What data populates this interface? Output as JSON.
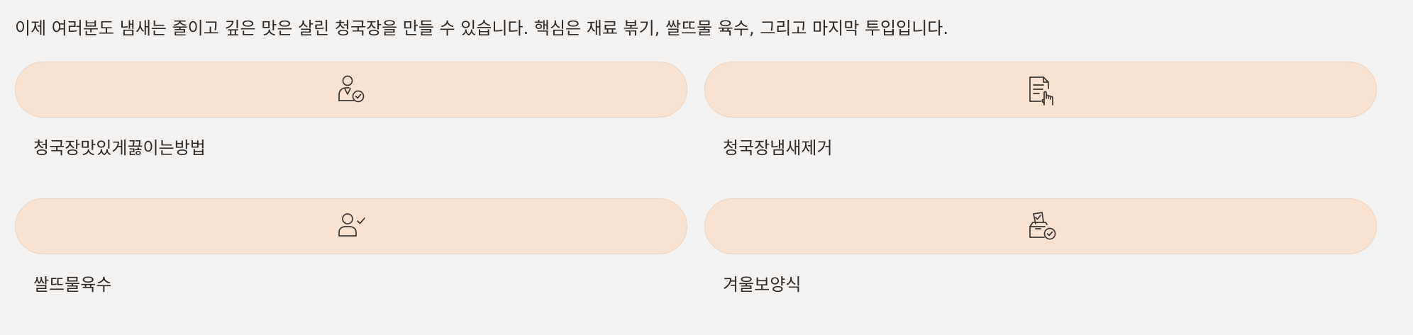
{
  "intro_text": "이제 여러분도 냄새는 줄이고 깊은 맛은 살린 청국장을 만들 수 있습니다. 핵심은 재료 볶기, 쌀뜨물 육수, 그리고 마지막 투입입니다.",
  "cards": [
    {
      "label": "청국장맛있게끓이는방법",
      "icon": "person-check-icon"
    },
    {
      "label": "청국장냄새제거",
      "icon": "document-hand-icon"
    },
    {
      "label": "쌀뜨물육수",
      "icon": "user-check-icon"
    },
    {
      "label": "겨울보양식",
      "icon": "ballot-box-check-icon"
    }
  ]
}
